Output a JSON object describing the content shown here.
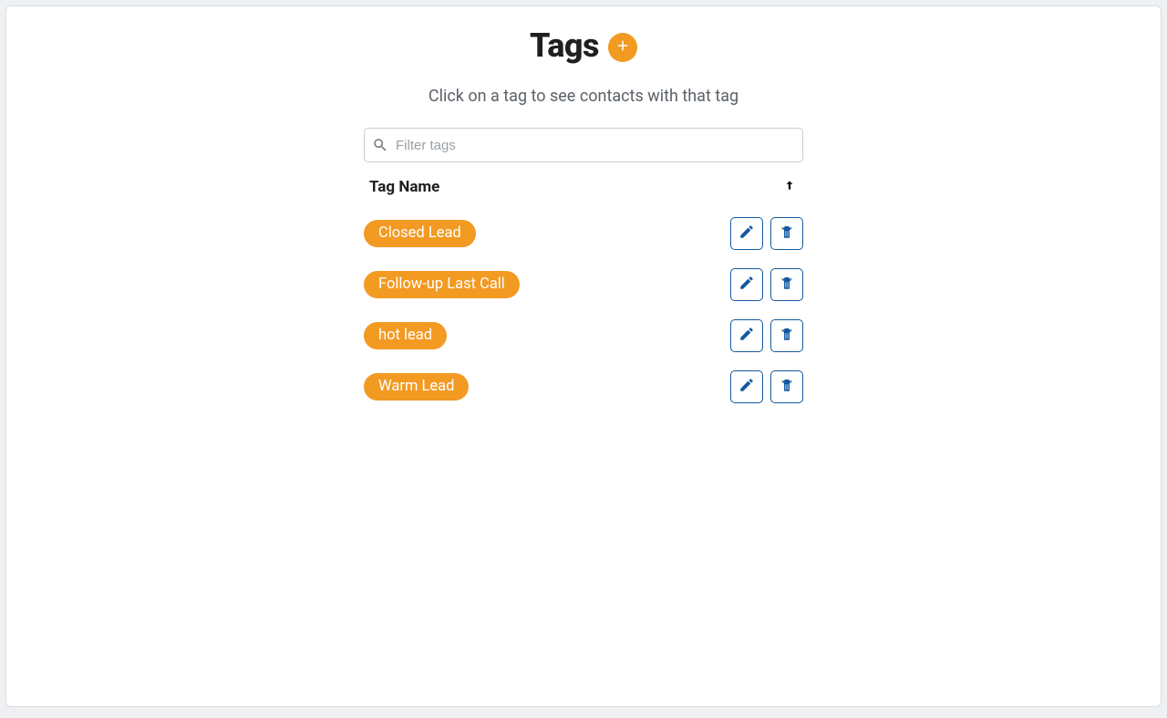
{
  "header": {
    "title": "Tags",
    "subtitle": "Click on a tag to see contacts with that tag"
  },
  "filter": {
    "placeholder": "Filter tags",
    "value": ""
  },
  "columns": {
    "name_label": "Tag Name"
  },
  "tags": [
    {
      "label": "Closed Lead"
    },
    {
      "label": "Follow-up Last Call"
    },
    {
      "label": "hot lead"
    },
    {
      "label": "Warm Lead"
    }
  ],
  "colors": {
    "accent": "#f29a22",
    "action_border": "#14599f"
  }
}
